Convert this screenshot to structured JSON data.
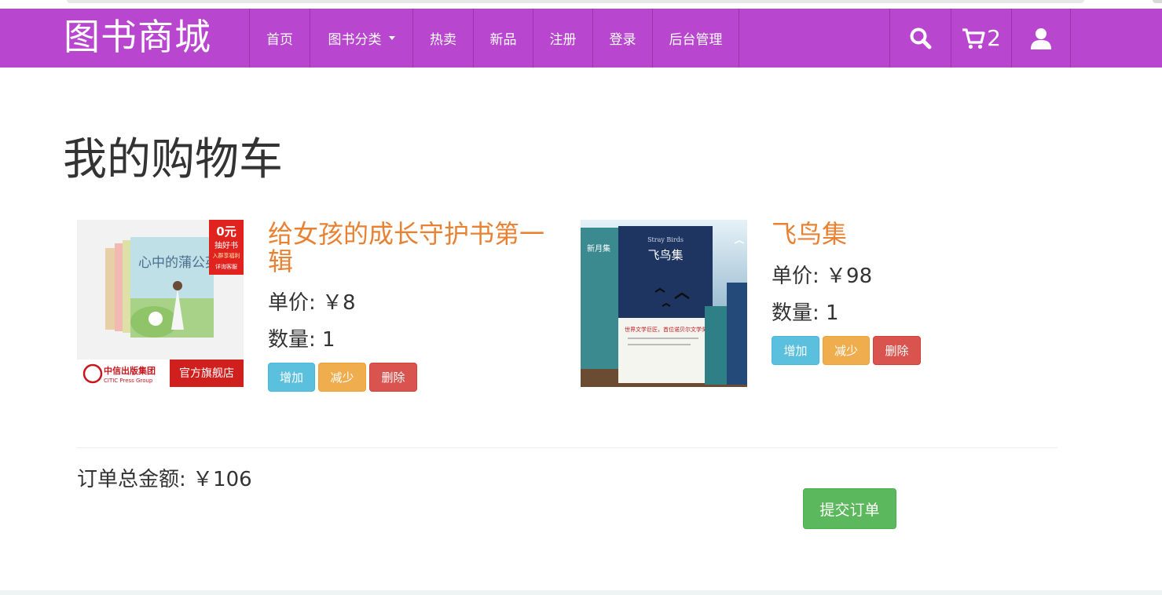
{
  "nav": {
    "brand": "图书商城",
    "items": [
      "首页",
      "图书分类",
      "热卖",
      "新品",
      "注册",
      "登录",
      "后台管理"
    ],
    "cart_count": "2",
    "icons": [
      "search-icon",
      "cart-icon",
      "user-icon"
    ],
    "colors": {
      "navbar": "#b846cf"
    }
  },
  "page": {
    "title": "我的购物车"
  },
  "cart": {
    "items": [
      {
        "title": "给女孩的成长守护书第一辑",
        "price": "单价: ￥8",
        "quantity": "数量: 1",
        "cover": {
          "badge_top": "0元",
          "badge_mid": "抽好书",
          "badge_sub": "入群享福利",
          "badge_bottom": "详询客服",
          "book_title": "心中的蒲公英",
          "publisher_cn": "中信出版集团",
          "publisher_en": "CITIC Press Group",
          "store": "官方旗舰店"
        }
      },
      {
        "title": "飞鸟集",
        "price": "单价: ￥98",
        "quantity": "数量: 1",
        "cover": {
          "en_title": "Stray Birds",
          "cn_title": "飞鸟集",
          "spine_title": "新月集",
          "tagline": "世界文学巨匠，首位诺贝尔文学奖获得者"
        }
      }
    ],
    "buttons": {
      "add": "增加",
      "minus": "减少",
      "delete": "删除"
    }
  },
  "summary": {
    "total": "订单总金额: ￥106",
    "submit": "提交订单"
  },
  "colors": {
    "title_orange": "#e88232",
    "btn_add": "#5bc0de",
    "btn_minus": "#f0ad4e",
    "btn_delete": "#d9534f",
    "btn_submit": "#5cb85c"
  }
}
